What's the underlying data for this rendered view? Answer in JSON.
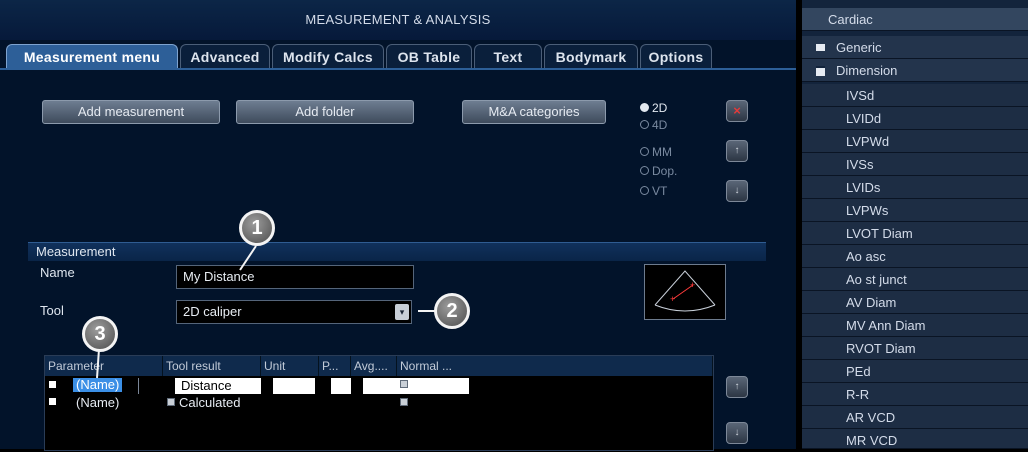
{
  "window_title": "MEASUREMENT & ANALYSIS",
  "tabs": [
    {
      "label": "Measurement menu",
      "active": true
    },
    {
      "label": "Advanced"
    },
    {
      "label": "Modify Calcs"
    },
    {
      "label": "OB Table"
    },
    {
      "label": "Text"
    },
    {
      "label": "Bodymark"
    },
    {
      "label": "Options"
    }
  ],
  "buttons": {
    "add_measurement": "Add measurement",
    "add_folder": "Add folder",
    "ma_categories": "M&A categories"
  },
  "modes": [
    {
      "label": "2D",
      "selected": true
    },
    {
      "label": "4D"
    },
    {
      "label": "MM"
    },
    {
      "label": "Dop."
    },
    {
      "label": "VT"
    }
  ],
  "side_buttons": {
    "delete": "×",
    "up": "↑",
    "down": "↓"
  },
  "measurement": {
    "section_title": "Measurement",
    "name_label": "Name",
    "name_value": "My Distance",
    "tool_label": "Tool",
    "tool_value": "2D caliper"
  },
  "param_table": {
    "headers": [
      "Parameter",
      "Tool result",
      "Unit",
      "P...",
      "Avg....",
      "Normal ..."
    ],
    "rows": [
      {
        "name": "(Name)",
        "tool_result": "Distance",
        "selected": true
      },
      {
        "name": "(Name)",
        "tool_result": "Calculated"
      }
    ]
  },
  "callouts": [
    "1",
    "2",
    "3"
  ],
  "sidebar": {
    "top": "Cardiac",
    "folders": [
      "Generic",
      "Dimension"
    ],
    "items": [
      "IVSd",
      "LVIDd",
      "LVPWd",
      "IVSs",
      "LVIDs",
      "LVPWs",
      "LVOT Diam",
      "Ao asc",
      "Ao st junct",
      "AV Diam",
      "MV Ann Diam",
      "RVOT Diam",
      "PEd",
      "R-R",
      "AR VCD",
      "MR VCD"
    ]
  },
  "colors": {
    "accent": "#2d5f98",
    "delete": "#c8202a",
    "background": "#02132a"
  }
}
